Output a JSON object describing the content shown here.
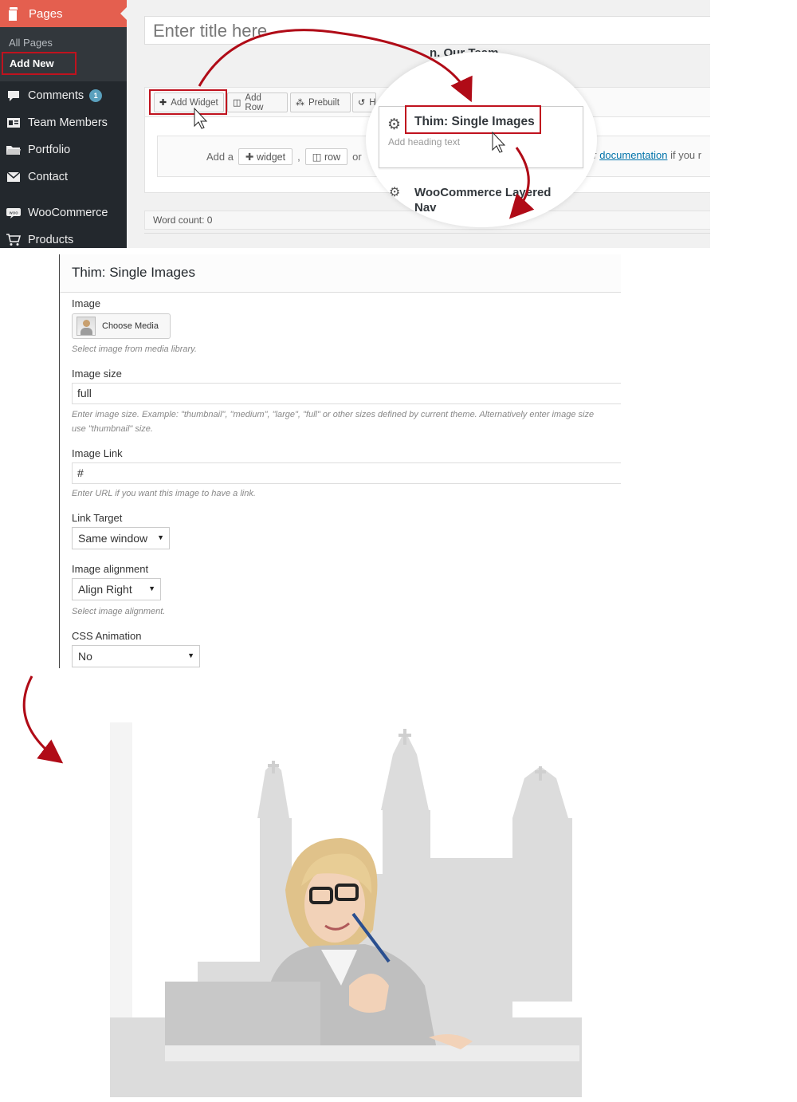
{
  "sidebar": {
    "pages_label": "Pages",
    "submenu": {
      "all_pages": "All Pages",
      "add_new": "Add New"
    },
    "items": [
      {
        "label": "Comments",
        "icon": "comment-icon",
        "badge": "1"
      },
      {
        "label": "Team Members",
        "icon": "id-card-icon"
      },
      {
        "label": "Portfolio",
        "icon": "folder-icon"
      },
      {
        "label": "Contact",
        "icon": "envelope-icon"
      },
      {
        "label": "WooCommerce",
        "icon": "woocommerce-icon"
      },
      {
        "label": "Products",
        "icon": "cart-icon"
      }
    ]
  },
  "editor": {
    "title_placeholder": "Enter title here",
    "title_behind": "n. Our Team",
    "toolbar": {
      "add_widget": "Add Widget",
      "add_row": "Add Row",
      "prebuilt": "Prebuilt",
      "history": "H"
    },
    "add_line": {
      "prefix": "Add a",
      "widget": "widget",
      "comma": ",",
      "row": "row",
      "or": "or"
    },
    "doc_line": {
      "prefix": "ur",
      "link": "documentation",
      "suffix": "if you r"
    },
    "word_count": "Word count: 0"
  },
  "widget_popup": {
    "title": "Thim: Single Images",
    "subtitle": "Add heading text",
    "next_title": "WooCommerce Layered Nav"
  },
  "form": {
    "heading": "Thim: Single Images",
    "image": {
      "label": "Image",
      "button": "Choose Media",
      "hint": "Select image from media library."
    },
    "image_size": {
      "label": "Image size",
      "value": "full",
      "hint_line1": "Enter image size. Example: \"thumbnail\", \"medium\", \"large\", \"full\" or other sizes defined by current theme. Alternatively enter image size",
      "hint_line2": "use \"thumbnail\" size."
    },
    "image_link": {
      "label": "Image Link",
      "value": "#",
      "hint": "Enter URL if you want this image to have a link."
    },
    "link_target": {
      "label": "Link Target",
      "value": "Same window"
    },
    "image_alignment": {
      "label": "Image alignment",
      "value": "Align Right",
      "hint": "Select image alignment."
    },
    "css_animation": {
      "label": "CSS Animation",
      "value": "No"
    }
  },
  "colors": {
    "accent_red": "#c0121e",
    "sidebar_bg": "#23282d",
    "pages_active": "#e45f4f",
    "link_blue": "#0073aa"
  }
}
